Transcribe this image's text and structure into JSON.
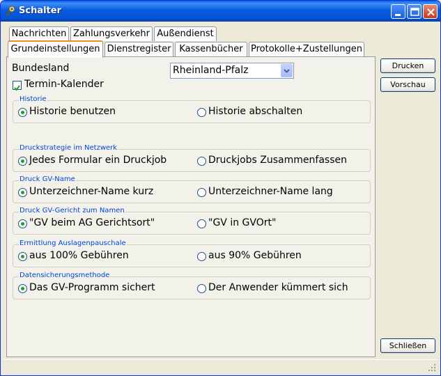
{
  "window": {
    "title": "Schalter"
  },
  "tabs_row1": [
    "Nachrichten",
    "Zahlungsverkehr",
    "Außendienst"
  ],
  "tabs_row2": [
    "Grundeinstellungen",
    "Dienstregister",
    "Kassenbücher",
    "Protokolle+Zustellungen"
  ],
  "bundesland": {
    "label": "Bundesland",
    "value": "Rheinland-Pfalz"
  },
  "termin": {
    "label": "Termin-Kalender",
    "checked": true
  },
  "groups": [
    {
      "title": "Historie",
      "opt1": "Historie benutzen",
      "opt2": "Historie abschalten",
      "selected": 1
    },
    {
      "title": "Druckstrategie im Netzwerk",
      "opt1": "Jedes Formular ein Druckjob",
      "opt2": "Druckjobs Zusammenfassen",
      "selected": 1
    },
    {
      "title": "Druck GV-Name",
      "opt1": "Unterzeichner-Name kurz",
      "opt2": "Unterzeichner-Name lang",
      "selected": 1
    },
    {
      "title": "Druck GV-Gericht zum Namen",
      "opt1": "\"GV beim AG Gerichtsort\"",
      "opt2": "\"GV in GVOrt\"",
      "selected": 1
    },
    {
      "title": "Ermittlung Auslagenpauschale",
      "opt1": "aus 100% Gebühren",
      "opt2": "aus 90% Gebühren",
      "selected": 1
    },
    {
      "title": "Datensicherungsmethode",
      "opt1": "Das GV-Programm sichert",
      "opt2": "Der Anwender kümmert sich",
      "selected": 1
    }
  ],
  "buttons": {
    "print": "Drucken",
    "preview": "Vorschau",
    "close": "Schließen"
  },
  "colors": {
    "titlebar": "#0a5ae0",
    "group_title": "#0046d5",
    "radio_dot": "#21a121",
    "active_tab_accent": "#e68b2c"
  }
}
